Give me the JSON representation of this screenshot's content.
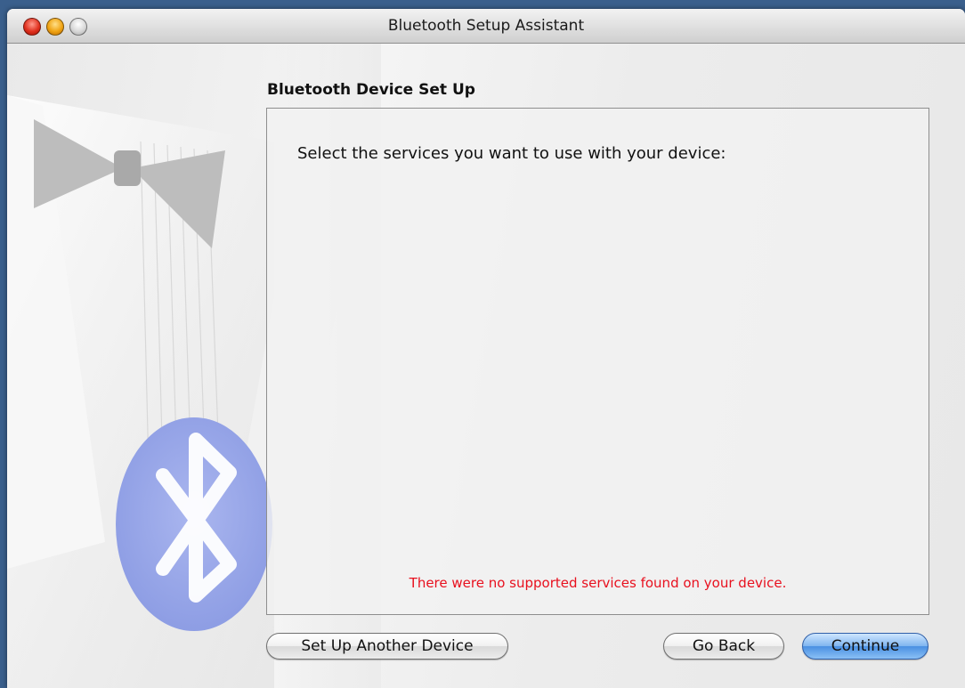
{
  "window": {
    "title": "Bluetooth Setup Assistant"
  },
  "main": {
    "heading": "Bluetooth Device Set Up",
    "prompt": "Select the services you want to use with your device:",
    "error_message": "There were no supported services found on your device."
  },
  "buttons": {
    "setup_another": "Set Up Another Device",
    "go_back": "Go Back",
    "continue": "Continue"
  },
  "colors": {
    "error": "#e8101e",
    "accent": "#4a90e2"
  },
  "icons": {
    "close": "close-button-icon",
    "minimize": "minimize-button-icon",
    "zoom": "zoom-button-icon",
    "art": "bluetooth-logo-icon"
  }
}
